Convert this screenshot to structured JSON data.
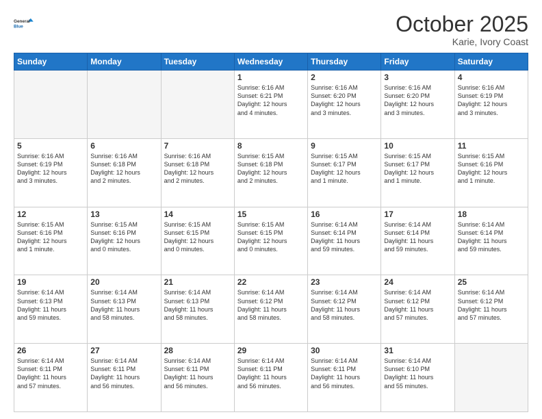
{
  "header": {
    "logo_line1": "General",
    "logo_line2": "Blue",
    "month": "October 2025",
    "location": "Karie, Ivory Coast"
  },
  "days_of_week": [
    "Sunday",
    "Monday",
    "Tuesday",
    "Wednesday",
    "Thursday",
    "Friday",
    "Saturday"
  ],
  "weeks": [
    [
      {
        "day": "",
        "info": ""
      },
      {
        "day": "",
        "info": ""
      },
      {
        "day": "",
        "info": ""
      },
      {
        "day": "1",
        "info": "Sunrise: 6:16 AM\nSunset: 6:21 PM\nDaylight: 12 hours\nand 4 minutes."
      },
      {
        "day": "2",
        "info": "Sunrise: 6:16 AM\nSunset: 6:20 PM\nDaylight: 12 hours\nand 3 minutes."
      },
      {
        "day": "3",
        "info": "Sunrise: 6:16 AM\nSunset: 6:20 PM\nDaylight: 12 hours\nand 3 minutes."
      },
      {
        "day": "4",
        "info": "Sunrise: 6:16 AM\nSunset: 6:19 PM\nDaylight: 12 hours\nand 3 minutes."
      }
    ],
    [
      {
        "day": "5",
        "info": "Sunrise: 6:16 AM\nSunset: 6:19 PM\nDaylight: 12 hours\nand 3 minutes."
      },
      {
        "day": "6",
        "info": "Sunrise: 6:16 AM\nSunset: 6:18 PM\nDaylight: 12 hours\nand 2 minutes."
      },
      {
        "day": "7",
        "info": "Sunrise: 6:16 AM\nSunset: 6:18 PM\nDaylight: 12 hours\nand 2 minutes."
      },
      {
        "day": "8",
        "info": "Sunrise: 6:15 AM\nSunset: 6:18 PM\nDaylight: 12 hours\nand 2 minutes."
      },
      {
        "day": "9",
        "info": "Sunrise: 6:15 AM\nSunset: 6:17 PM\nDaylight: 12 hours\nand 1 minute."
      },
      {
        "day": "10",
        "info": "Sunrise: 6:15 AM\nSunset: 6:17 PM\nDaylight: 12 hours\nand 1 minute."
      },
      {
        "day": "11",
        "info": "Sunrise: 6:15 AM\nSunset: 6:16 PM\nDaylight: 12 hours\nand 1 minute."
      }
    ],
    [
      {
        "day": "12",
        "info": "Sunrise: 6:15 AM\nSunset: 6:16 PM\nDaylight: 12 hours\nand 1 minute."
      },
      {
        "day": "13",
        "info": "Sunrise: 6:15 AM\nSunset: 6:16 PM\nDaylight: 12 hours\nand 0 minutes."
      },
      {
        "day": "14",
        "info": "Sunrise: 6:15 AM\nSunset: 6:15 PM\nDaylight: 12 hours\nand 0 minutes."
      },
      {
        "day": "15",
        "info": "Sunrise: 6:15 AM\nSunset: 6:15 PM\nDaylight: 12 hours\nand 0 minutes."
      },
      {
        "day": "16",
        "info": "Sunrise: 6:14 AM\nSunset: 6:14 PM\nDaylight: 11 hours\nand 59 minutes."
      },
      {
        "day": "17",
        "info": "Sunrise: 6:14 AM\nSunset: 6:14 PM\nDaylight: 11 hours\nand 59 minutes."
      },
      {
        "day": "18",
        "info": "Sunrise: 6:14 AM\nSunset: 6:14 PM\nDaylight: 11 hours\nand 59 minutes."
      }
    ],
    [
      {
        "day": "19",
        "info": "Sunrise: 6:14 AM\nSunset: 6:13 PM\nDaylight: 11 hours\nand 59 minutes."
      },
      {
        "day": "20",
        "info": "Sunrise: 6:14 AM\nSunset: 6:13 PM\nDaylight: 11 hours\nand 58 minutes."
      },
      {
        "day": "21",
        "info": "Sunrise: 6:14 AM\nSunset: 6:13 PM\nDaylight: 11 hours\nand 58 minutes."
      },
      {
        "day": "22",
        "info": "Sunrise: 6:14 AM\nSunset: 6:12 PM\nDaylight: 11 hours\nand 58 minutes."
      },
      {
        "day": "23",
        "info": "Sunrise: 6:14 AM\nSunset: 6:12 PM\nDaylight: 11 hours\nand 58 minutes."
      },
      {
        "day": "24",
        "info": "Sunrise: 6:14 AM\nSunset: 6:12 PM\nDaylight: 11 hours\nand 57 minutes."
      },
      {
        "day": "25",
        "info": "Sunrise: 6:14 AM\nSunset: 6:12 PM\nDaylight: 11 hours\nand 57 minutes."
      }
    ],
    [
      {
        "day": "26",
        "info": "Sunrise: 6:14 AM\nSunset: 6:11 PM\nDaylight: 11 hours\nand 57 minutes."
      },
      {
        "day": "27",
        "info": "Sunrise: 6:14 AM\nSunset: 6:11 PM\nDaylight: 11 hours\nand 56 minutes."
      },
      {
        "day": "28",
        "info": "Sunrise: 6:14 AM\nSunset: 6:11 PM\nDaylight: 11 hours\nand 56 minutes."
      },
      {
        "day": "29",
        "info": "Sunrise: 6:14 AM\nSunset: 6:11 PM\nDaylight: 11 hours\nand 56 minutes."
      },
      {
        "day": "30",
        "info": "Sunrise: 6:14 AM\nSunset: 6:11 PM\nDaylight: 11 hours\nand 56 minutes."
      },
      {
        "day": "31",
        "info": "Sunrise: 6:14 AM\nSunset: 6:10 PM\nDaylight: 11 hours\nand 55 minutes."
      },
      {
        "day": "",
        "info": ""
      }
    ]
  ]
}
